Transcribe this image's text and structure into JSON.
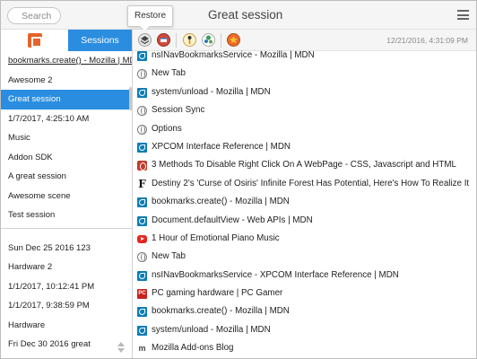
{
  "header": {
    "search_placeholder": "Search",
    "tooltip": "Restore",
    "title": "Great session",
    "menu_icon": "hamburger-menu-icon"
  },
  "sidebar": {
    "tab_icon": "orange-session-icon",
    "tab_label": "Sessions",
    "items": [
      {
        "label": "bookmarks.create() - Mozilla | MDN",
        "state": "underlined"
      },
      {
        "label": "Awesome 2",
        "state": ""
      },
      {
        "label": "Great session",
        "state": "selected"
      },
      {
        "label": "1/7/2017, 4:25:10 AM",
        "state": ""
      },
      {
        "label": "Music",
        "state": ""
      },
      {
        "label": "Addon SDK",
        "state": ""
      },
      {
        "label": "A great session",
        "state": ""
      },
      {
        "label": "Awesome scene",
        "state": ""
      },
      {
        "label": "Test session",
        "state": ""
      }
    ],
    "history": [
      {
        "label": "Sun Dec 25 2016 123"
      },
      {
        "label": "Hardware 2"
      },
      {
        "label": "1/1/2017, 10:12:41 PM"
      },
      {
        "label": "1/1/2017, 9:38:59 PM"
      },
      {
        "label": "Hardware"
      },
      {
        "label": "Fri Dec 30 2016 great"
      }
    ]
  },
  "toolbar": {
    "buttons": [
      "layers-icon",
      "restore-window-icon",
      "pin-icon",
      "tree-icon",
      "star-icon"
    ],
    "datetime": "12/21/2016, 4:31:09 PM"
  },
  "tabs_list": [
    {
      "title": "nsINavBookmarksService - Mozilla | MDN",
      "favicon": "mdn"
    },
    {
      "title": "New Tab",
      "favicon": "globe"
    },
    {
      "title": "system/unload - Mozilla | MDN",
      "favicon": "mdn"
    },
    {
      "title": "Session Sync",
      "favicon": "globe"
    },
    {
      "title": "Options",
      "favicon": "globe"
    },
    {
      "title": "XPCOM Interface Reference | MDN",
      "favicon": "mdn"
    },
    {
      "title": "3 Methods To Disable Right Click On A WebPage - CSS, Javascript and HTML",
      "favicon": "opera"
    },
    {
      "title": "Destiny 2's 'Curse of Osiris' Infinite Forest Has Potential, Here's How To Realize It",
      "favicon": "forbes"
    },
    {
      "title": "bookmarks.create() - Mozilla | MDN",
      "favicon": "mdn"
    },
    {
      "title": "Document.defaultView - Web APIs | MDN",
      "favicon": "mdn"
    },
    {
      "title": "1 Hour of Emotional Piano Music",
      "favicon": "youtube"
    },
    {
      "title": "New Tab",
      "favicon": "globe"
    },
    {
      "title": "nsINavBookmarksService - XPCOM Interface Reference | MDN",
      "favicon": "mdn"
    },
    {
      "title": "PC gaming hardware | PC Gamer",
      "favicon": "pcgamer"
    },
    {
      "title": "bookmarks.create() - Mozilla | MDN",
      "favicon": "mdn"
    },
    {
      "title": "system/unload - Mozilla | MDN",
      "favicon": "mdn"
    },
    {
      "title": "Mozilla Add-ons Blog",
      "favicon": "addons"
    }
  ]
}
